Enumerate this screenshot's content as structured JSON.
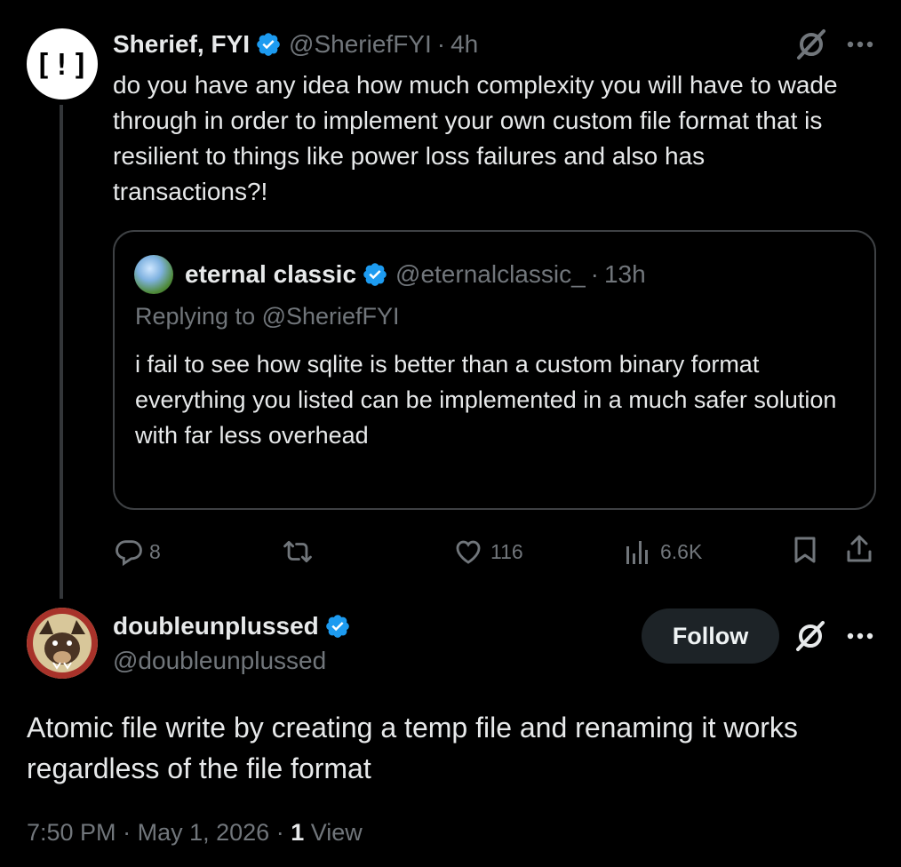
{
  "parent_tweet": {
    "avatar_text": "[!]",
    "name": "Sherief, FYI",
    "handle": "@SheriefFYI",
    "separator": "·",
    "time": "4h",
    "text": "do you have any idea how much complexity you will have to wade through in order to implement your own custom file format that is resilient to things like power loss failures and also has transactions?!",
    "quote": {
      "name": "eternal classic",
      "handle": "@eternalclassic_",
      "separator": "·",
      "time": "13h",
      "replying_to": "Replying to @SheriefFYI",
      "text_lines": [
        "i fail to see how sqlite is better than a custom binary format",
        "everything you listed can be implemented in a much safer solution with far less overhead"
      ]
    },
    "actions": {
      "replies": "8",
      "likes": "116",
      "views": "6.6K"
    }
  },
  "main_tweet": {
    "name": "doubleunplussed",
    "handle": "@doubleunplussed",
    "follow_label": "Follow",
    "text": "Atomic file write by creating a temp file and renaming it works regardless of the file format",
    "time": "7:50 PM",
    "separator": "·",
    "date": "May 1, 2026",
    "separator2": "·",
    "view_count": "1",
    "view_label": "View"
  },
  "colors": {
    "background": "#000000",
    "text": "#e7e9ea",
    "muted": "#71767b",
    "verified": "#1d9bf0",
    "border": "#3e4144"
  },
  "icons": [
    "grok-icon",
    "more-icon",
    "reply-icon",
    "retweet-icon",
    "like-icon",
    "views-icon",
    "bookmark-icon",
    "share-icon",
    "verified-badge-icon"
  ]
}
